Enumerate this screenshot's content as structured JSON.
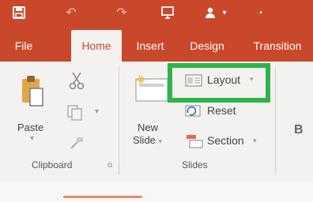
{
  "quick_access": {
    "icons": [
      "save-icon",
      "undo-icon",
      "redo-icon",
      "present-icon",
      "user-icon",
      "dropdown-icon"
    ]
  },
  "tabs": [
    {
      "label": "File"
    },
    {
      "label": "Home"
    },
    {
      "label": "Insert"
    },
    {
      "label": "Design"
    },
    {
      "label": "Transition"
    }
  ],
  "clipboard": {
    "paste_label": "Paste",
    "group_label": "Clipboard",
    "launcher": "⧉"
  },
  "slides": {
    "new_label": "New",
    "slide_label": "Slide",
    "slide_caret": "▾",
    "layout_label": "Layout",
    "layout_caret": "▾",
    "reset_label": "Reset",
    "section_label": "Section",
    "section_caret": "▾",
    "group_label": "Slides"
  },
  "font": {
    "bold": "B"
  },
  "colors": {
    "ribbon_accent": "#c9482b",
    "highlight": "#2fb34a"
  }
}
